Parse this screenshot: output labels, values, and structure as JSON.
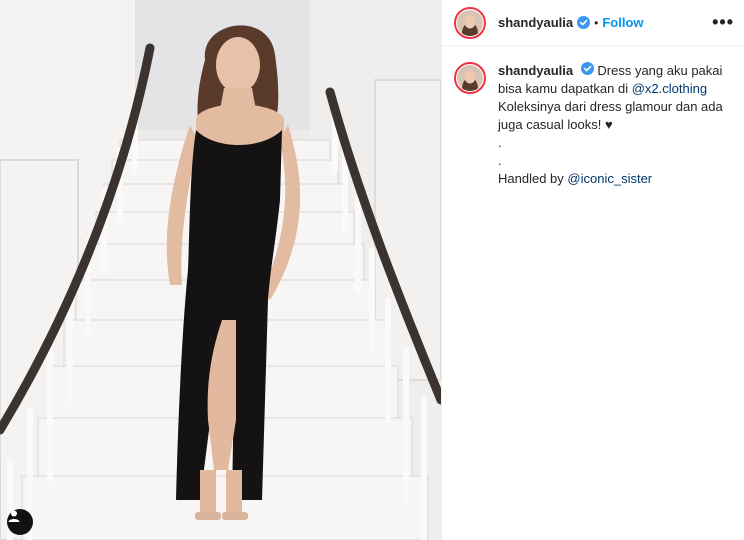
{
  "post": {
    "author": {
      "username": "shandyaulia",
      "verified": true,
      "follow_label": "Follow",
      "separator": "•"
    },
    "more_label": "•••",
    "caption": {
      "text_1": "Dress yang aku pakai bisa kamu dapatkan di",
      "mention_1": "@x2.clothing",
      "text_2": "Koleksinya dari dress glamour dan ada juga casual looks! ♥",
      "dot_1": ".",
      "dot_2": ".",
      "text_3": "Handled by",
      "mention_2": "@iconic_sister"
    }
  },
  "icons": {
    "verified": "verified-badge-icon",
    "user_tag": "user-tag-icon",
    "more": "more-options-icon"
  },
  "colors": {
    "link_blue": "#0095f6",
    "mention_blue": "#00376b",
    "verified_blue": "#3897f0",
    "story_ring": "#e23a4e"
  }
}
